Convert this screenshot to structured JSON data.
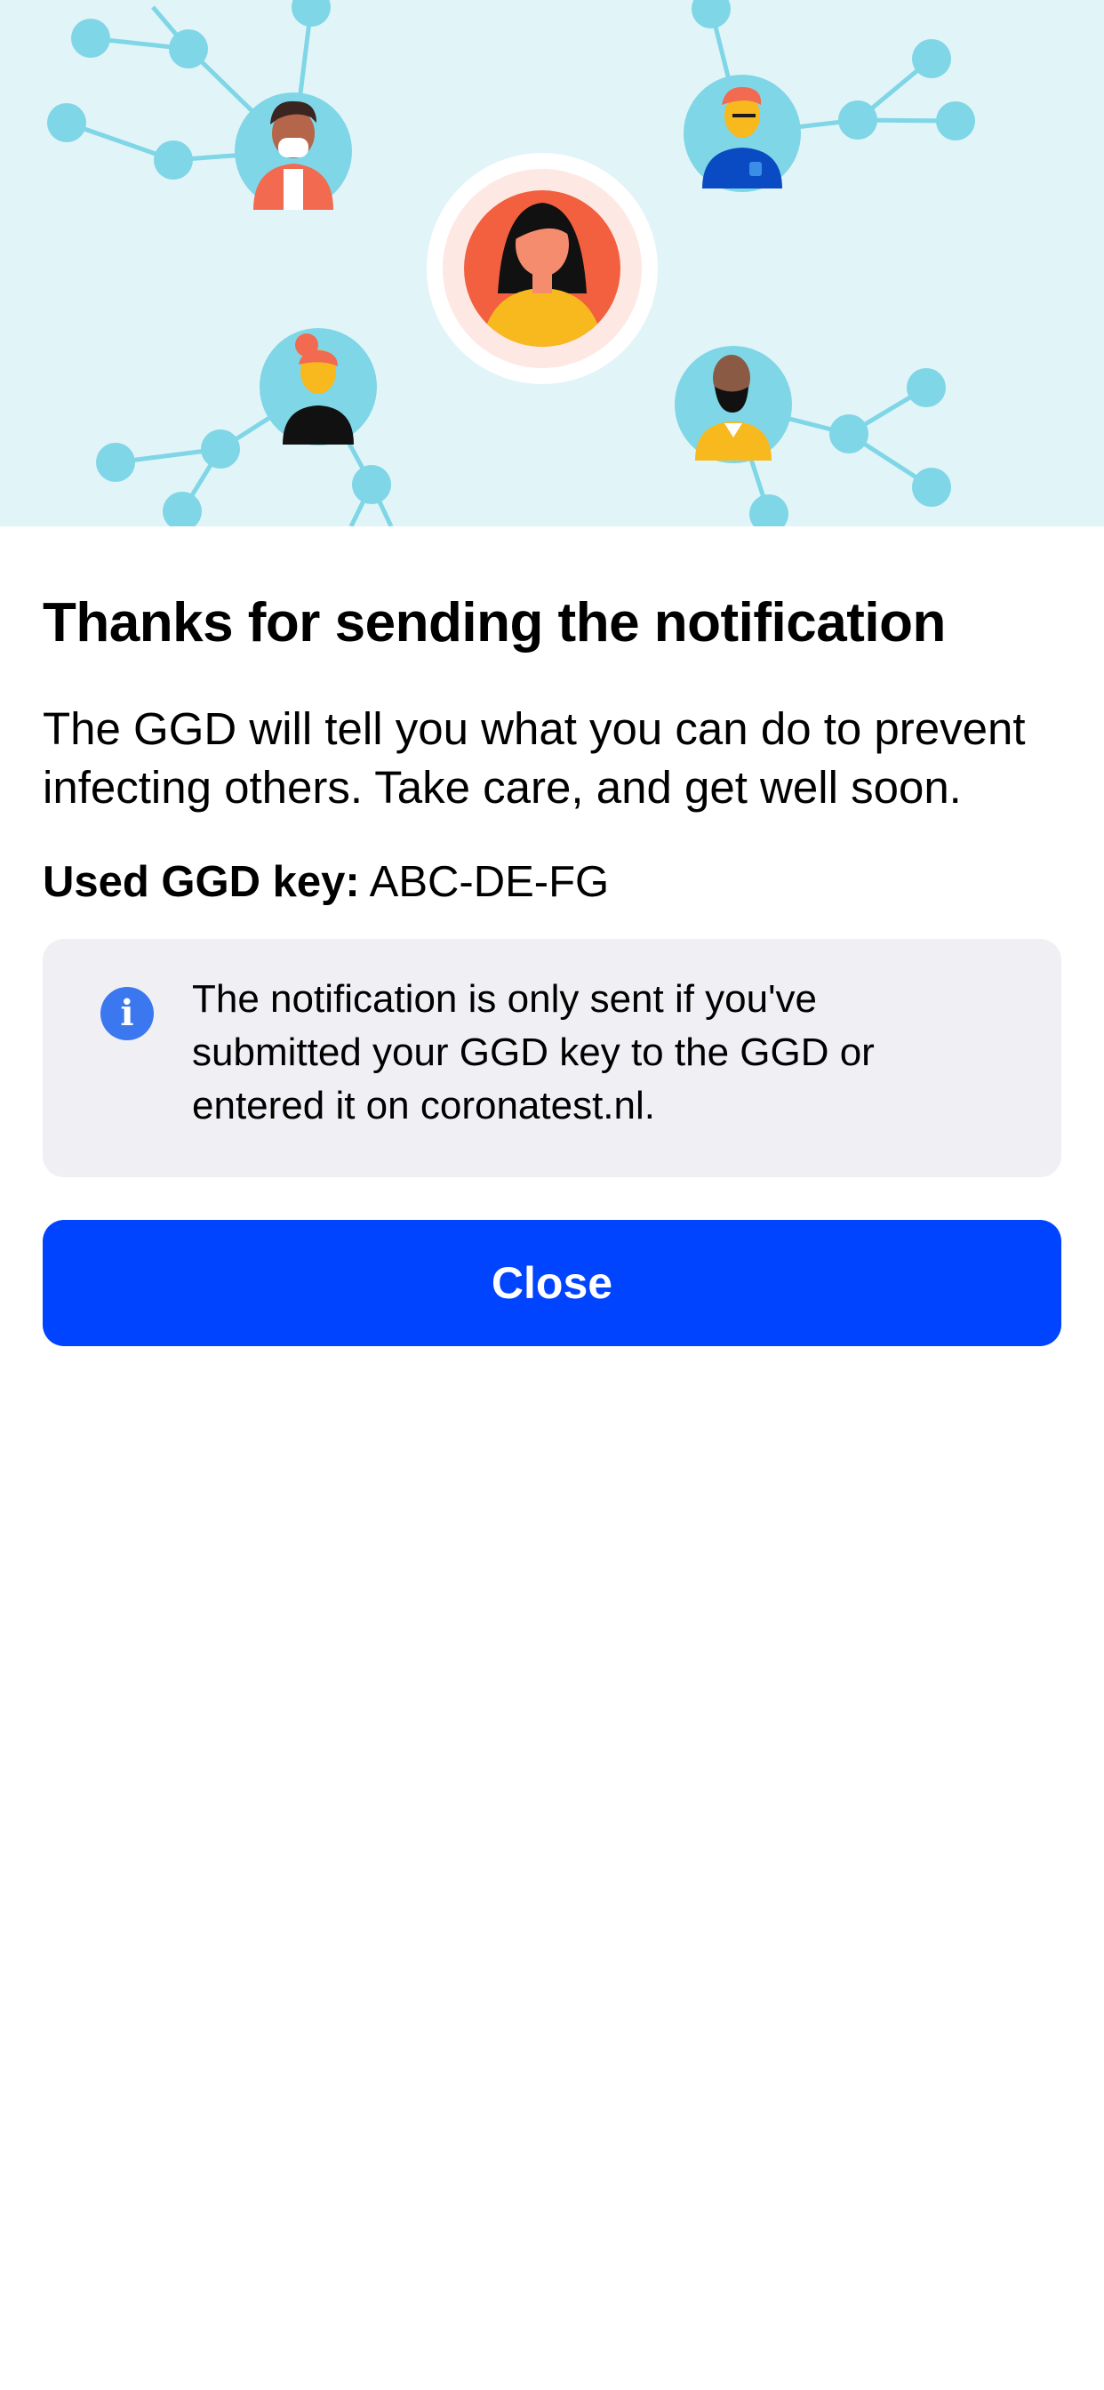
{
  "colors": {
    "hero_background": "#e1f4f8",
    "network_nodes": "#7fd6e6",
    "accent_button": "#0044ff",
    "info_card_background": "#efeff4",
    "info_icon": "#3b78f0"
  },
  "hero": {
    "illustration": "contact-network-people-illustration"
  },
  "title": "Thanks for sending the notification",
  "body": "The GGD will tell you what you can do to prevent infecting others. Take care, and get well soon.",
  "key": {
    "label": "Used GGD key:",
    "value": "ABC-DE-FG"
  },
  "info": {
    "icon": "info-icon",
    "text": "The notification is only sent if you've submitted your GGD key to the GGD or entered it on coronatest.nl."
  },
  "close_button": {
    "label": "Close"
  }
}
